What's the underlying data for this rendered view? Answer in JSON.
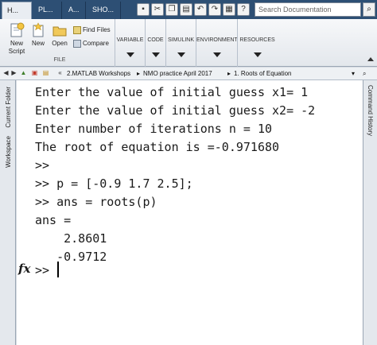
{
  "tabs": [
    {
      "label": "H..."
    },
    {
      "label": "PL..."
    },
    {
      "label": "A..."
    },
    {
      "label": "SHO..."
    }
  ],
  "search": {
    "placeholder": "Search Documentation"
  },
  "ribbon": {
    "new_script_label": "New\nScript",
    "new_label": "New",
    "open_label": "Open",
    "find_files_label": "Find Files",
    "compare_label": "Compare",
    "file_section": "FILE",
    "groups": [
      "VARIABLE",
      "CODE",
      "SIMULINK",
      "ENVIRONMENT",
      "RESOURCES"
    ]
  },
  "address": {
    "crumbs": [
      "2.MATLAB Workshops",
      "NMO practice April 2017",
      "1. Roots of Equation"
    ]
  },
  "side": {
    "current_folder": "Current Folder",
    "workspace": "Workspace",
    "command_history": "Command History"
  },
  "console": {
    "lines": [
      "Enter the value of initial guess x1= 1",
      "Enter the value of initial guess x2= -2",
      "Enter number of iterations n = 10",
      "The root of equation is =-0.971680",
      ">>",
      ">> p = [-0.9 1.7 2.5];",
      ">> ans = roots(p)",
      "ans =",
      "    2.8601",
      "   -0.9712",
      ">>"
    ],
    "fx": "fx"
  }
}
